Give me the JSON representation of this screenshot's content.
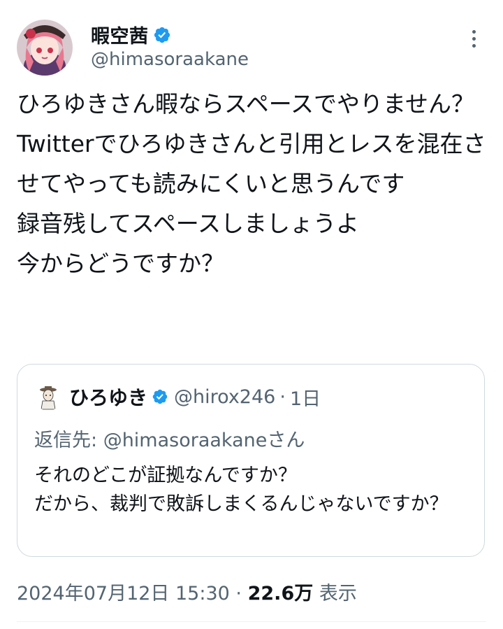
{
  "author": {
    "display_name": "暇空茜",
    "handle": "@himasoraakane"
  },
  "tweet": {
    "text": "ひろゆきさん暇ならスペースでやりません？\nTwitterでひろゆきさんと引用とレスを混在させてやっても読みにくいと思うんです\n録音残してスペースしましょうよ\n今からどうですか？"
  },
  "quoted_tweet": {
    "display_name": "ひろゆき",
    "handle": "@hirox246",
    "separator": "·",
    "time": "1日",
    "reply_prefix": "返信先: ",
    "reply_to": "@himasoraakane",
    "reply_suffix": "さん",
    "text": "それのどこが証拠なんですか？\nだから、裁判で敗訴しまくるんじゃないですか？"
  },
  "meta": {
    "timestamp": "2024年07月12日 15:30",
    "separator": "·",
    "views_count": "22.6万",
    "views_label": "表示"
  },
  "colors": {
    "text": "#0f1419",
    "secondary": "#536471",
    "verified": "#1d9bf0",
    "border": "#cfd9de"
  },
  "icons": {
    "verified": "verified-badge-icon",
    "more": "more-options-icon"
  }
}
